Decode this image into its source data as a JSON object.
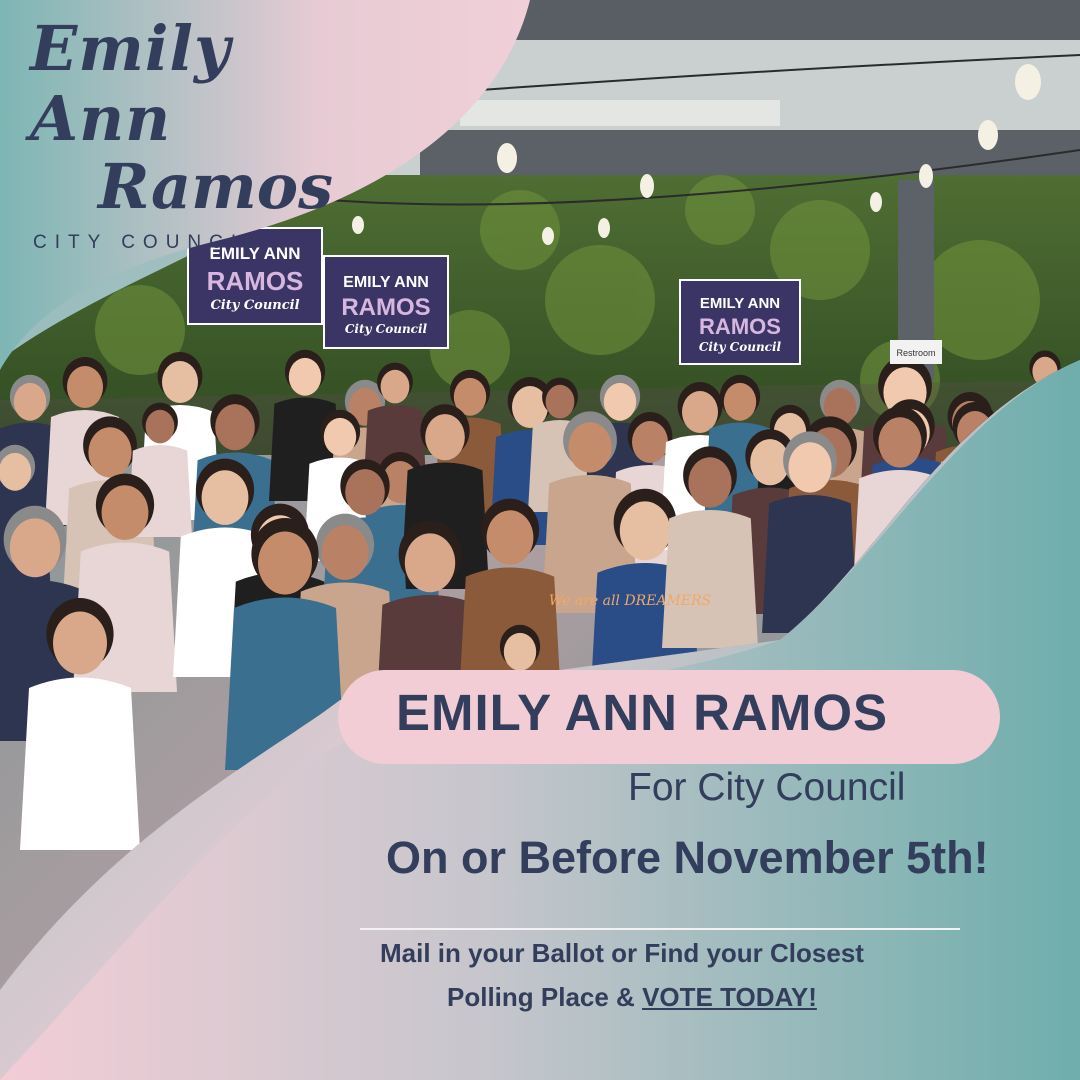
{
  "logo": {
    "line1": "Emily Ann",
    "line2": "Ramos",
    "subtitle": "CITY COUNCIL"
  },
  "photo": {
    "signs": [
      {
        "name": "EMILY ANN",
        "surname": "RAMOS",
        "office": "City Council"
      },
      {
        "name": "EMILY ANN",
        "surname": "RAMOS",
        "office": "City Council"
      },
      {
        "name": "EMILY ANN",
        "surname": "RAMOS",
        "office": "City Council"
      }
    ],
    "shirt_text": "We are all DREAMERS",
    "restroom_sign": "Restroom"
  },
  "headline": "EMILY ANN RAMOS",
  "subheadline": "For City Council",
  "date_line": "On or Before November 5th!",
  "cta": {
    "line1": "Mail in your Ballot or Find your Closest",
    "line2_prefix": "Polling Place & ",
    "line2_link": "VOTE TODAY!"
  },
  "colors": {
    "navy": "#333d5c",
    "pink": "#f2cdd6",
    "teal": "#74b0ae",
    "foliage": "#3d5a2a",
    "sign_purple": "#3b3566"
  }
}
